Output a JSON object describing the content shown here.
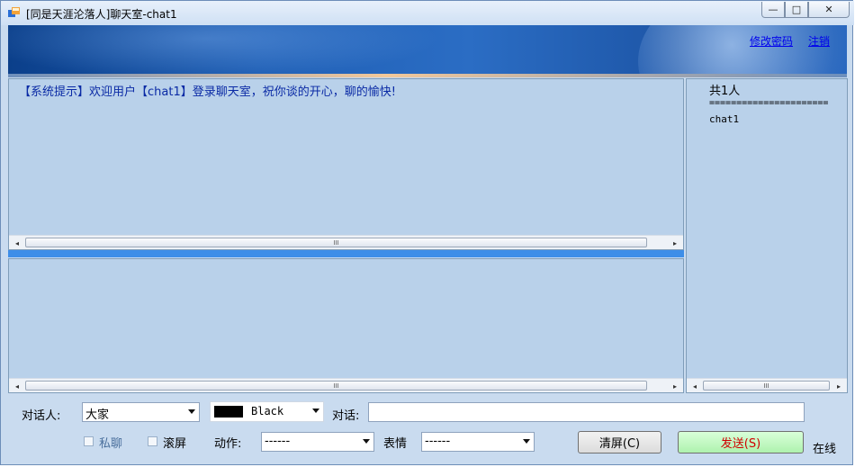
{
  "window": {
    "title": "[同是天涯沦落人]聊天室-chat1",
    "minimize_glyph": "—",
    "maximize_glyph": "□",
    "close_glyph": "✕"
  },
  "header": {
    "change_password_link": "修改密码",
    "logout_link": "注销"
  },
  "messages": {
    "system_message": "【系统提示】欢迎用户【chat1】登录聊天室，祝你谈的开心，聊的愉快!"
  },
  "user_list": {
    "count_label": "共1人",
    "separator": "======================",
    "users": [
      "chat1"
    ]
  },
  "scrollbar": {
    "left_arrow": "◂",
    "right_arrow": "▸",
    "grip": "III"
  },
  "controls": {
    "target_label": "对话人:",
    "target_value": "大家",
    "color_value": "Black",
    "dialog_label": "对话:",
    "dialog_value": "",
    "private_label": "私聊",
    "scroll_label": "滚屏",
    "action_label": "动作:",
    "action_value": "------",
    "emotion_label": "表情",
    "emotion_value": "------",
    "clear_button": "清屏(C)",
    "send_button": "发送(S)",
    "status_text": "在线"
  },
  "colors": {
    "panel_bg": "#b9d1ea",
    "divider": "#3d8ee8",
    "system_text": "#0a2aa5",
    "send_text": "#d00000",
    "send_bg": "#c6f7c6"
  }
}
